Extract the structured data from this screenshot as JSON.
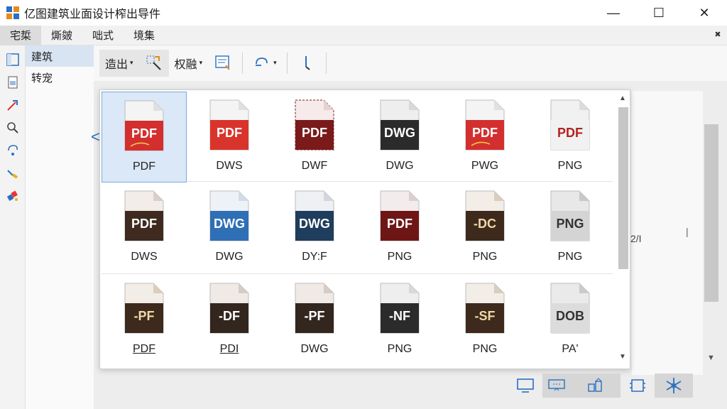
{
  "window": {
    "title": "亿图建筑业面设计榨出导件",
    "controls": [
      "minimize-icon",
      "maximize-icon",
      "close-icon"
    ],
    "close_glyph": "✕",
    "max_glyph": "☐",
    "min_glyph": "—"
  },
  "menu": {
    "items": [
      "宅梊",
      "燍皴",
      "咄式",
      "境集"
    ],
    "active_index": 0,
    "pin_glyph": "✖"
  },
  "tree": {
    "items": [
      "建筑",
      "转宠"
    ],
    "selected_index": 0
  },
  "toolbar": {
    "export_label": "造出",
    "view_label": "权融",
    "caret": "▾"
  },
  "gallery": {
    "items": [
      {
        "badge": "PDF",
        "label": "PDF",
        "style": "red-logo",
        "underline": false
      },
      {
        "badge": "PDF",
        "label": "DWS",
        "style": "red",
        "underline": false
      },
      {
        "badge": "PDF",
        "label": "DWF",
        "style": "darkred-dashed",
        "underline": false
      },
      {
        "badge": "DWG",
        "label": "DWG",
        "style": "black",
        "underline": false
      },
      {
        "badge": "PDF",
        "label": "PWG",
        "style": "red-logo",
        "underline": false
      },
      {
        "badge": "PDF",
        "label": "PNG",
        "style": "light-redtext",
        "underline": false
      },
      {
        "badge": "PDF",
        "label": "DWS",
        "style": "brown",
        "underline": false
      },
      {
        "badge": "DWG",
        "label": "DWG",
        "style": "blue",
        "underline": false
      },
      {
        "badge": "DWG",
        "label": "DY:F",
        "style": "navy",
        "underline": false
      },
      {
        "badge": "PDF",
        "label": "PNG",
        "style": "maroon",
        "underline": false
      },
      {
        "badge": "-DC",
        "label": "PNG",
        "style": "brown-gold",
        "underline": false
      },
      {
        "badge": "PNG",
        "label": "PNG",
        "style": "grey",
        "underline": false
      },
      {
        "badge": "-PF",
        "label": "PDF",
        "style": "brown-gold",
        "underline": true
      },
      {
        "badge": "-DF",
        "label": "PDI",
        "style": "darkbrown",
        "underline": true
      },
      {
        "badge": "-PF",
        "label": "DWG",
        "style": "darkbrown",
        "underline": false
      },
      {
        "badge": "-NF",
        "label": "PNG",
        "style": "black",
        "underline": false
      },
      {
        "badge": "-SF",
        "label": "PNG",
        "style": "brown-gold",
        "underline": false
      },
      {
        "badge": "DOB",
        "label": "PA'",
        "style": "grey-db",
        "underline": false
      }
    ],
    "selected_index": 0
  },
  "background": {
    "side_label": "2/I",
    "tick": "|"
  },
  "scroll": {
    "up": "▲",
    "down": "▼",
    "left_arrow": "<"
  },
  "colors": {
    "accent": "#2a6fc0",
    "selection_bg": "#dbe8f7",
    "red": "#d32f2f",
    "darkred": "#8b1a1a",
    "brown": "#4a2e1e",
    "navy": "#1f3d5c",
    "blue": "#2f6fb5",
    "grey": "#d8d8d8"
  },
  "bottom_toolbar": [
    "monitor-icon",
    "screen-share-icon",
    "shapes-icon",
    "frame-icon",
    "snowflake-icon"
  ]
}
